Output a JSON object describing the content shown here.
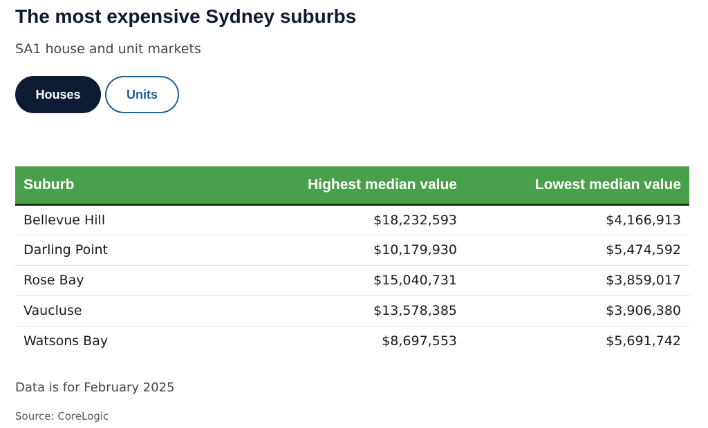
{
  "header": {
    "title": "The most expensive Sydney suburbs",
    "subtitle": "SA1 house and unit markets"
  },
  "tabs": [
    {
      "label": "Houses",
      "selected": true
    },
    {
      "label": "Units",
      "selected": false
    }
  ],
  "table": {
    "columns": [
      "Suburb",
      "Highest median value",
      "Lowest median value"
    ],
    "rows": [
      [
        "Bellevue Hill",
        "$18,232,593",
        "$4,166,913"
      ],
      [
        "Darling Point",
        "$10,179,930",
        "$5,474,592"
      ],
      [
        "Rose Bay",
        "$15,040,731",
        "$3,859,017"
      ],
      [
        "Vaucluse",
        "$13,578,385",
        "$3,906,380"
      ],
      [
        "Watsons Bay",
        "$8,697,553",
        "$5,691,742"
      ]
    ]
  },
  "footer": {
    "note": "Data is for February 2025",
    "source": "Source: CoreLogic"
  },
  "colors": {
    "header_green": "#4aa04a",
    "active_tab_navy": "#0d1b33",
    "inactive_tab_blue": "#1f5f9a"
  }
}
